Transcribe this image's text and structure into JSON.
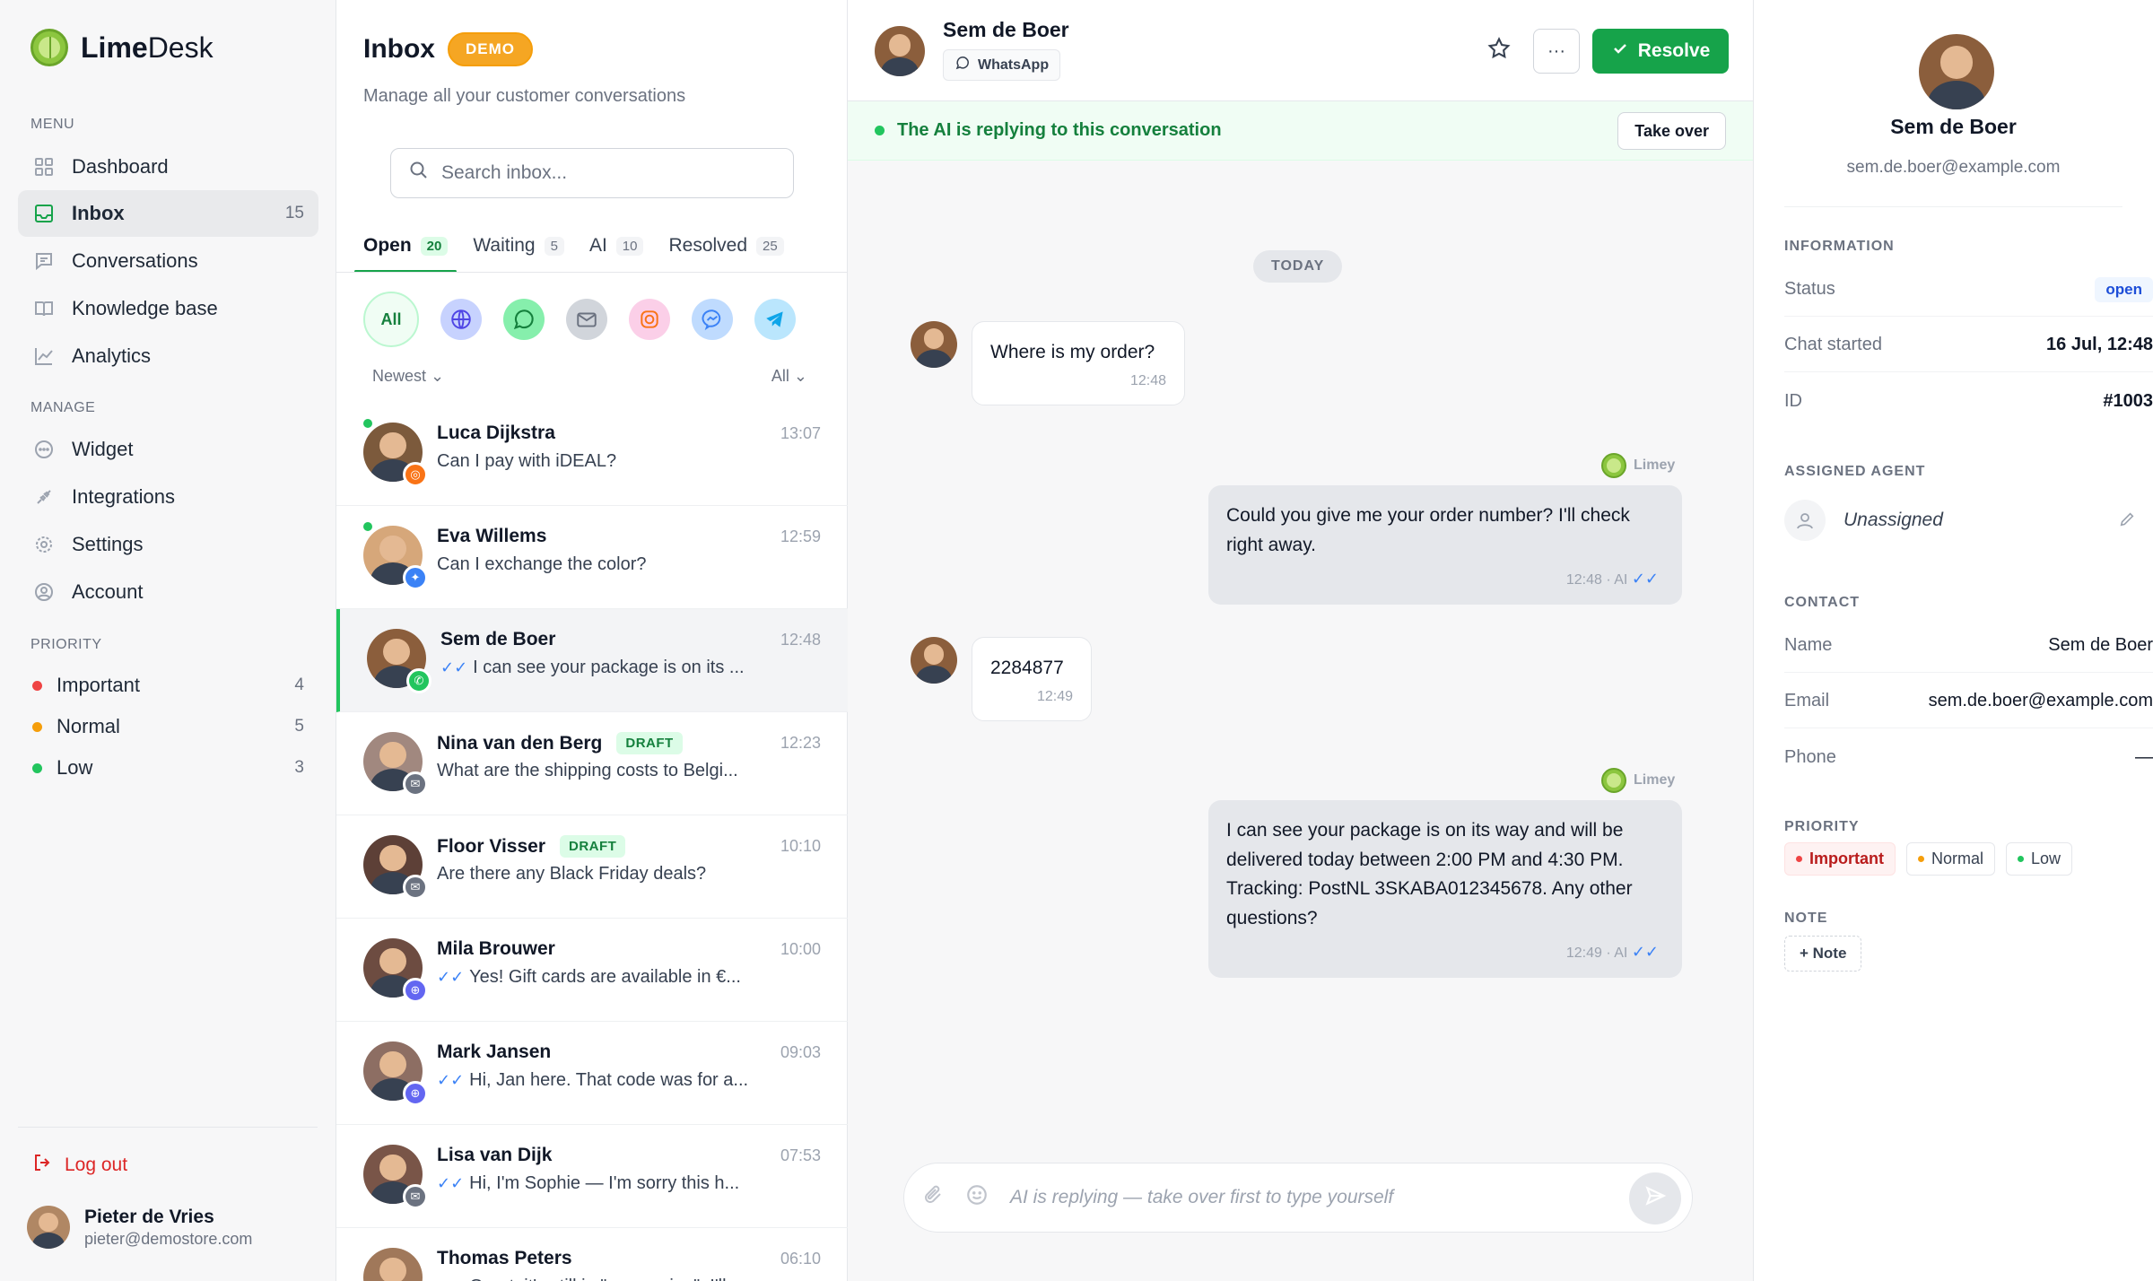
{
  "app": {
    "brand_strong": "Lime",
    "brand_rest": "Desk"
  },
  "sidebar": {
    "menu_label": "MENU",
    "manage_label": "MANAGE",
    "priority_label": "PRIORITY",
    "menu": [
      {
        "label": "Dashboard",
        "icon": "grid-icon"
      },
      {
        "label": "Inbox",
        "icon": "inbox-icon",
        "count": "15",
        "active": true
      },
      {
        "label": "Conversations",
        "icon": "chat-icon"
      },
      {
        "label": "Knowledge base",
        "icon": "book-icon"
      },
      {
        "label": "Analytics",
        "icon": "chart-icon"
      }
    ],
    "manage": [
      {
        "label": "Widget",
        "icon": "widget-icon"
      },
      {
        "label": "Integrations",
        "icon": "plug-icon"
      },
      {
        "label": "Settings",
        "icon": "gear-icon"
      },
      {
        "label": "Account",
        "icon": "user-icon"
      }
    ],
    "priorities": [
      {
        "label": "Important",
        "count": "4",
        "color": "#ef4444"
      },
      {
        "label": "Normal",
        "count": "5",
        "color": "#f59e0b"
      },
      {
        "label": "Low",
        "count": "3",
        "color": "#22c55e"
      }
    ],
    "logout": "Log out",
    "user": {
      "name": "Pieter de Vries",
      "email": "pieter@demostore.com"
    }
  },
  "inbox": {
    "title": "Inbox",
    "badge": "DEMO",
    "subtitle": "Manage all your customer conversations",
    "search_placeholder": "Search inbox...",
    "tabs": [
      {
        "label": "Open",
        "count": "20",
        "active": true
      },
      {
        "label": "Waiting",
        "count": "5"
      },
      {
        "label": "AI",
        "count": "10"
      },
      {
        "label": "Resolved",
        "count": "25"
      }
    ],
    "channel_all": "All",
    "sort": "Newest",
    "filter": "All",
    "conversations": [
      {
        "name": "Luca Dijkstra",
        "time": "13:07",
        "preview": "Can I pay with iDEAL?",
        "channel": "instagram",
        "online": true
      },
      {
        "name": "Eva Willems",
        "time": "12:59",
        "preview": "Can I exchange the color?",
        "channel": "messenger",
        "online": true
      },
      {
        "name": "Sem de Boer",
        "time": "12:48",
        "preview": "I can see your package is on its ...",
        "channel": "whatsapp",
        "tick": true,
        "selected": true
      },
      {
        "name": "Nina van den Berg",
        "time": "12:23",
        "preview": "What are the shipping costs to Belgi...",
        "channel": "email",
        "draft": "DRAFT"
      },
      {
        "name": "Floor Visser",
        "time": "10:10",
        "preview": "Are there any Black Friday deals?",
        "channel": "email",
        "draft": "DRAFT"
      },
      {
        "name": "Mila Brouwer",
        "time": "10:00",
        "preview": "Yes! Gift cards are available in €...",
        "channel": "web",
        "tick": true
      },
      {
        "name": "Mark Jansen",
        "time": "09:03",
        "preview": "Hi, Jan here. That code was for a...",
        "channel": "web",
        "tick": true
      },
      {
        "name": "Lisa van Dijk",
        "time": "07:53",
        "preview": "Hi, I'm Sophie — I'm sorry this h...",
        "channel": "email",
        "tick": true
      },
      {
        "name": "Thomas Peters",
        "time": "06:10",
        "preview": "Great, it's still in \"processing\". I'll...",
        "channel": "web",
        "tick": true
      }
    ]
  },
  "chat": {
    "contact_name": "Sem de Boer",
    "channel": "WhatsApp",
    "resolve_label": "Resolve",
    "more_label": "···",
    "ai_notice": "The AI is replying to this conversation",
    "take_over": "Take over",
    "day_label": "TODAY",
    "bot_name": "Limey",
    "messages": [
      {
        "dir": "in",
        "text": "Where is my order?",
        "meta": "12:48"
      },
      {
        "dir": "out",
        "text": "Could you give me your order number? I'll check right away.",
        "meta": "12:48 · AI"
      },
      {
        "dir": "in",
        "text": "2284877",
        "meta": "12:49"
      },
      {
        "dir": "out",
        "text": "I can see your package is on its way and will be delivered today between 2:00 PM and 4:30 PM. Tracking: PostNL 3SKABA012345678. Any other questions?",
        "meta": "12:49 · AI"
      }
    ],
    "composer_placeholder": "AI is replying — take over first to type yourself"
  },
  "details": {
    "name": "Sem de Boer",
    "email": "sem.de.boer@example.com",
    "information_label": "INFORMATION",
    "status_key": "Status",
    "status_value": "open",
    "started_key": "Chat started",
    "started_value": "16 Jul, 12:48",
    "id_key": "ID",
    "id_value": "#1003",
    "agent_label": "ASSIGNED AGENT",
    "agent_value": "Unassigned",
    "contact_label": "CONTACT",
    "contact_name_key": "Name",
    "contact_name_value": "Sem de Boer",
    "contact_email_key": "Email",
    "contact_email_value": "sem.de.boer@example.com",
    "contact_phone_key": "Phone",
    "contact_phone_value": "—",
    "priority_label": "PRIORITY",
    "priority_chips": [
      "Important",
      "Normal",
      "Low"
    ],
    "note_label": "NOTE",
    "note_button": "+ Note"
  }
}
